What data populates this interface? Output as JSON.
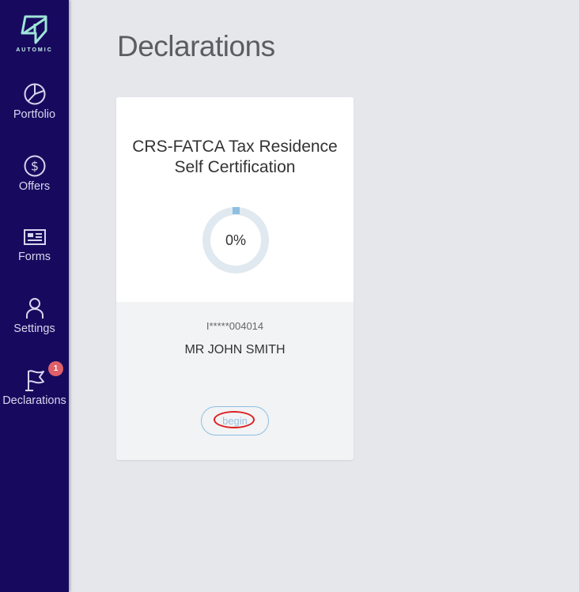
{
  "app": {
    "logo_text": "AUTOMIC"
  },
  "sidebar": {
    "items": [
      {
        "label": "Portfolio",
        "icon": "pie-chart-icon"
      },
      {
        "label": "Offers",
        "icon": "dollar-circle-icon"
      },
      {
        "label": "Forms",
        "icon": "id-card-icon"
      },
      {
        "label": "Settings",
        "icon": "user-icon"
      },
      {
        "label": "Declarations",
        "icon": "flag-icon",
        "badge": "1"
      }
    ]
  },
  "main": {
    "title": "Declarations",
    "card": {
      "title": "CRS-FATCA Tax Residence Self Certification",
      "progress_percent": 0,
      "progress_label": "0%",
      "account": "I*****004014",
      "holder": "MR JOHN SMITH",
      "button_label": "begin"
    }
  },
  "colors": {
    "sidebar_bg": "#170a5e",
    "accent": "#8fbfe0",
    "badge": "#e0606a",
    "logo": "#9fe5d8"
  }
}
